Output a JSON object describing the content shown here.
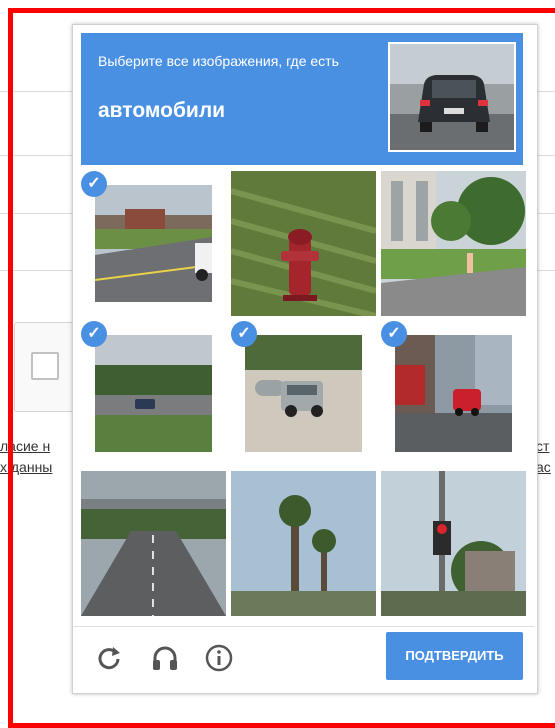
{
  "captcha": {
    "instruction": "Выберите все изображения, где есть",
    "target": "автомобили",
    "verify_label": "ПОДТВЕРДИТЬ",
    "accent_color": "#4a90e2",
    "tiles": [
      {
        "content": "road-with-truck",
        "selected": true
      },
      {
        "content": "fire-hydrant",
        "selected": false
      },
      {
        "content": "building-lawn",
        "selected": false
      },
      {
        "content": "highway-car",
        "selected": true
      },
      {
        "content": "suv-parking-lot",
        "selected": true
      },
      {
        "content": "city-street-red-car",
        "selected": true
      },
      {
        "content": "highway-overpass",
        "selected": false
      },
      {
        "content": "palm-trees",
        "selected": false
      },
      {
        "content": "traffic-light",
        "selected": false
      }
    ],
    "footer_icons": [
      "reload-icon",
      "audio-icon",
      "info-icon"
    ]
  },
  "background": {
    "consent_text_left_1": "ласие н",
    "consent_text_left_2": "х данны",
    "consent_text_right_1": "ст",
    "consent_text_right_2": "ас"
  }
}
